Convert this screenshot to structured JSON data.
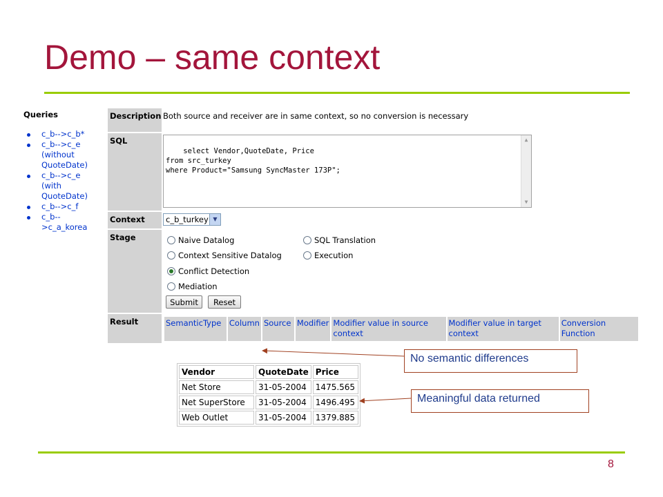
{
  "slide": {
    "title": "Demo – same context",
    "page_number": "8"
  },
  "queries": {
    "heading": "Queries",
    "items": [
      {
        "lines": [
          "c_b-->c_b*"
        ]
      },
      {
        "lines": [
          "c_b-->c_e",
          "(without",
          "QuoteDate)"
        ]
      },
      {
        "lines": [
          "c_b-->c_e",
          "(with",
          "QuoteDate)"
        ]
      },
      {
        "lines": [
          "c_b-->c_f"
        ]
      },
      {
        "lines": [
          "c_b--",
          ">c_a_korea"
        ]
      }
    ]
  },
  "form": {
    "description_label": "Description",
    "description_value": "Both source and receiver are in same context, so no conversion is necessary",
    "sql_label": "SQL",
    "sql_text": "select Vendor,QuoteDate, Price\nfrom src_turkey\nwhere Product=\"Samsung SyncMaster 173P\";",
    "context_label": "Context",
    "context_value": "c_b_turkey",
    "stage_label": "Stage",
    "stages": [
      {
        "label": "Naive Datalog",
        "checked": false
      },
      {
        "label": "SQL Translation",
        "checked": false
      },
      {
        "label": "Context Sensitive Datalog",
        "checked": false
      },
      {
        "label": "Execution",
        "checked": false
      },
      {
        "label": "Conflict Detection",
        "checked": true
      },
      {
        "label": "Mediation",
        "checked": false
      }
    ],
    "submit_label": "Submit",
    "reset_label": "Reset",
    "result_label": "Result",
    "result_columns": [
      "SemanticType",
      "Column",
      "Source",
      "Modifier",
      "Modifier value in source context",
      "Modifier value in target context",
      "Conversion Function"
    ]
  },
  "data_table": {
    "headers": [
      "Vendor",
      "QuoteDate",
      "Price"
    ],
    "rows": [
      [
        "Net Store",
        "31-05-2004",
        "1475.565"
      ],
      [
        "Net SuperStore",
        "31-05-2004",
        "1496.495"
      ],
      [
        "Web Outlet",
        "31-05-2004",
        "1379.885"
      ]
    ]
  },
  "callouts": {
    "no_semantic": "No semantic differences",
    "meaningful": "Meaningful data returned"
  },
  "colors": {
    "title": "#a3153b",
    "rule": "#99cc00",
    "link": "#0033cc",
    "label_bg": "#d3d3d3"
  }
}
